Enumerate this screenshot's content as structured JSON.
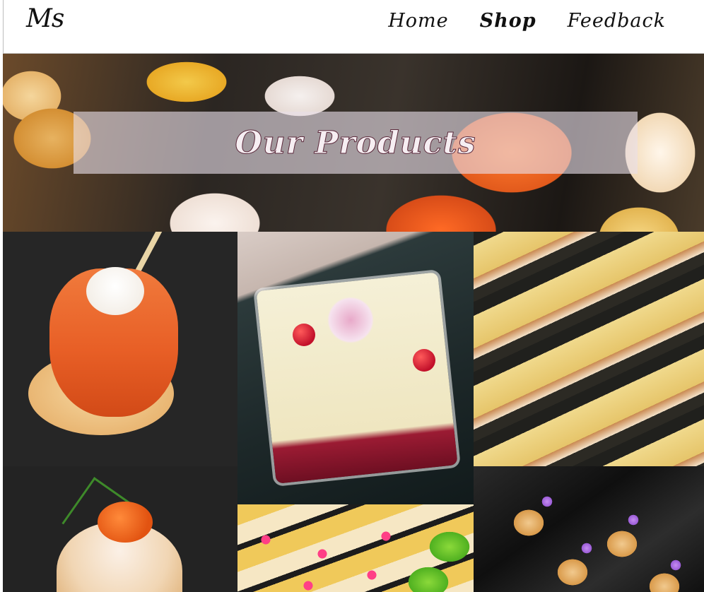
{
  "header": {
    "logo": "Ms",
    "nav": [
      {
        "label": "Home",
        "active": false
      },
      {
        "label": "Shop",
        "active": true
      },
      {
        "label": "Feedback",
        "active": false
      }
    ]
  },
  "hero": {
    "title": "Our Products"
  },
  "products": [
    {
      "image": "smoked-salmon-canape"
    },
    {
      "image": "panna-cotta-verrine"
    },
    {
      "image": "lobster-potato-bites"
    },
    {
      "image": "salmon-roe-tartlet"
    },
    {
      "image": "flower-petit-fours"
    },
    {
      "image": "cream-puff-tray"
    }
  ],
  "colors": {
    "header_bg": "#ffffff",
    "hero_band": "#e8dee8",
    "hero_title_outline": "#5b2a3c"
  }
}
